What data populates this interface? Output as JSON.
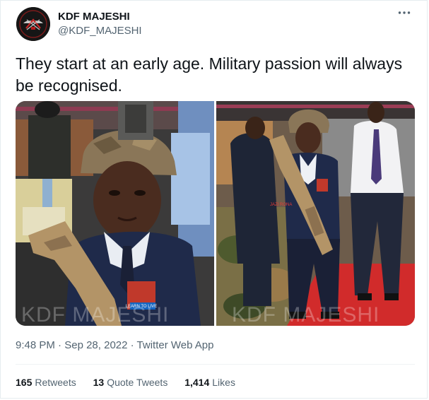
{
  "author": {
    "display_name": "KDF MAJESHI",
    "handle": "@KDF_MAJESHI"
  },
  "more_icon": "more-dots-icon",
  "tweet": {
    "text": "They start at an early age. Military passion will always be recognised.",
    "watermark_left": "KDF MAJESHI",
    "watermark_right": "KDF MAJESHI",
    "badge_text_left": "LEARN TO LIVE",
    "badge_text_right": "JAZI RONA"
  },
  "meta": {
    "time": "9:48 PM",
    "separator": "·",
    "date": "Sep 28, 2022",
    "source": "Twitter Web App"
  },
  "stats": {
    "retweets_count": "165",
    "retweets_label": "Retweets",
    "quotes_count": "13",
    "quotes_label": "Quote Tweets",
    "likes_count": "1,414",
    "likes_label": "Likes"
  }
}
